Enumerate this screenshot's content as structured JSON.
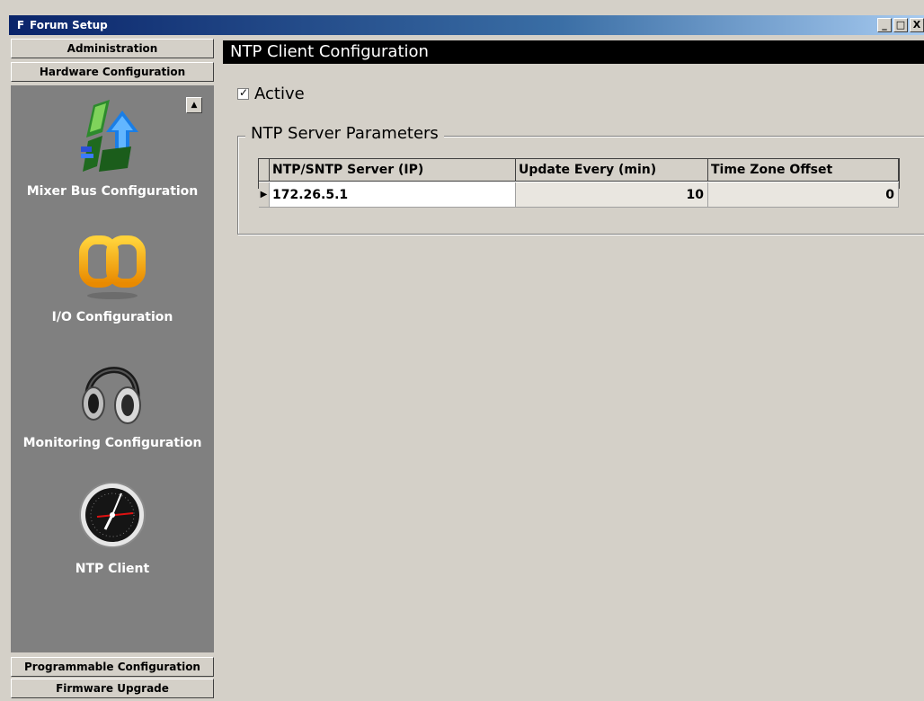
{
  "window": {
    "title": "Forum Setup",
    "logo_letter": "F",
    "minimize_label": "_",
    "maximize_label": "□",
    "close_label": "X"
  },
  "sidebar": {
    "sections_top": [
      {
        "label": "Administration"
      },
      {
        "label": "Hardware Configuration"
      }
    ],
    "items": [
      {
        "label": "Mixer Bus Configuration",
        "icon": "mixer-bus-icon"
      },
      {
        "label": "I/O Configuration",
        "icon": "io-link-icon"
      },
      {
        "label": "Monitoring Configuration",
        "icon": "headphones-icon"
      },
      {
        "label": "NTP Client",
        "icon": "clock-icon"
      }
    ],
    "sections_bottom": [
      {
        "label": "Programmable Configuration"
      },
      {
        "label": "Firmware Upgrade"
      }
    ]
  },
  "main": {
    "header": "NTP Client Configuration",
    "active": {
      "label": "Active",
      "checked": true
    },
    "group_title": "NTP Server Parameters",
    "grid": {
      "columns": [
        "NTP/SNTP Server (IP)",
        "Update Every (min)",
        "Time Zone Offset"
      ],
      "rows": [
        {
          "server": "172.26.5.1",
          "update": "10",
          "offset": "0"
        }
      ]
    }
  }
}
